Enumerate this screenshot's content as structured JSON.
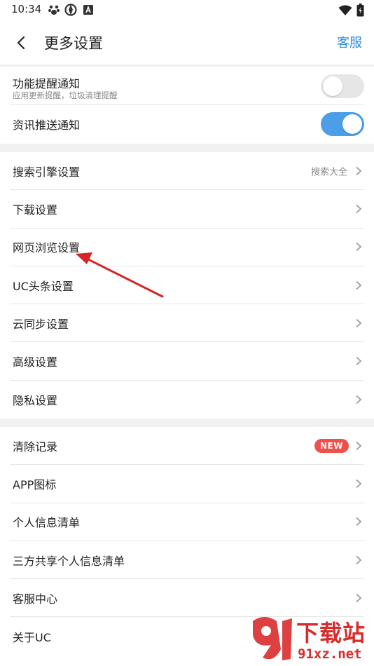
{
  "status_bar": {
    "time": "10:34",
    "icons_left": [
      "paw-icon",
      "aperture-icon",
      "a-box-icon"
    ],
    "icons_right": [
      "wifi-icon",
      "battery-icon"
    ]
  },
  "header": {
    "title": "更多设置",
    "action_label": "客服",
    "accent_color": "#2f8fe3"
  },
  "notifications": [
    {
      "label": "功能提醒通知",
      "sub": "应用更新提醒，垃圾清理提醒",
      "toggle": "off"
    },
    {
      "label": "资讯推送通知",
      "toggle": "on"
    }
  ],
  "settings": [
    {
      "label": "搜索引擎设置",
      "value": "搜索大全"
    },
    {
      "label": "下载设置"
    },
    {
      "label": "网页浏览设置"
    },
    {
      "label": "UC头条设置"
    },
    {
      "label": "云同步设置"
    },
    {
      "label": "高级设置"
    },
    {
      "label": "隐私设置"
    }
  ],
  "others": [
    {
      "label": "清除记录",
      "badge": "NEW"
    },
    {
      "label": "APP图标"
    },
    {
      "label": "个人信息清单"
    },
    {
      "label": "三方共享个人信息清单"
    },
    {
      "label": "客服中心"
    },
    {
      "label": "关于UC"
    }
  ],
  "watermark": {
    "main": "下载站",
    "url": "91xz.net"
  }
}
